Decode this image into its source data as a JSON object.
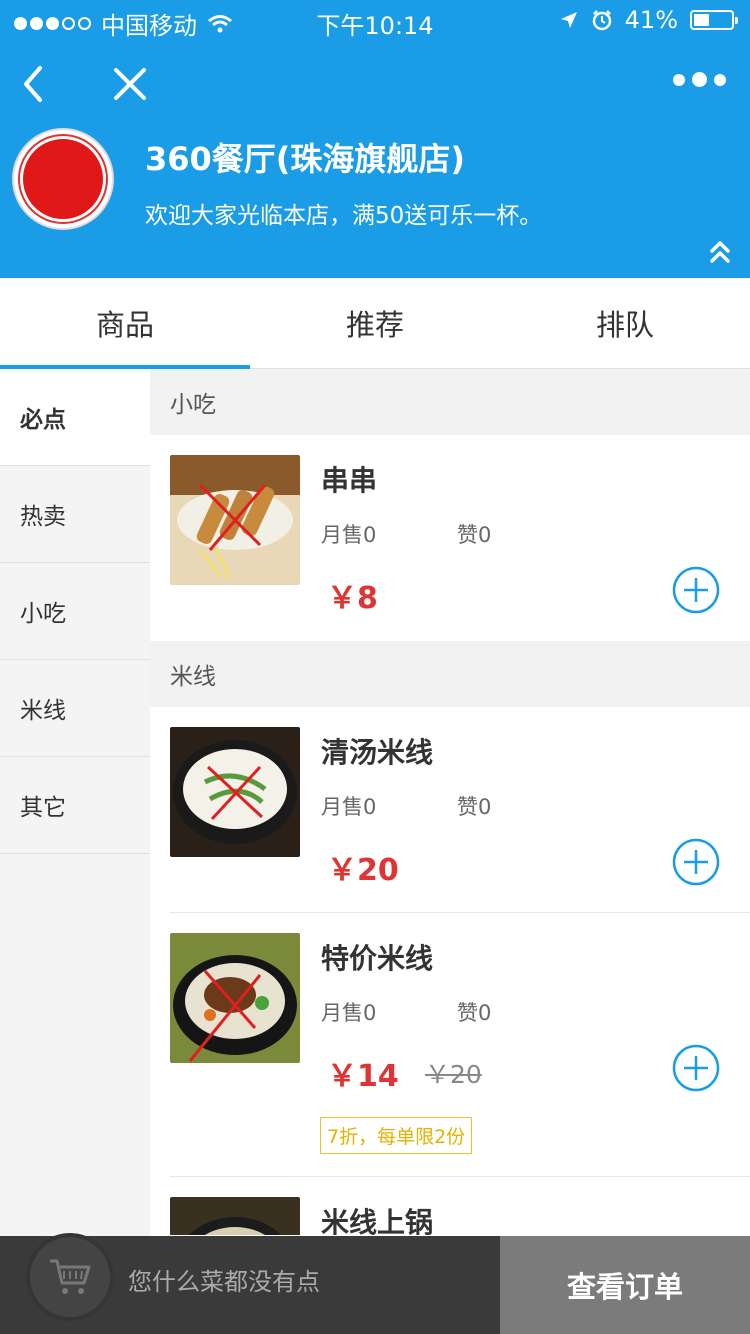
{
  "status_bar": {
    "carrier": "中国移动",
    "time": "下午10:14",
    "battery": "41%",
    "battery_level": 0.41
  },
  "shop": {
    "name": "360餐厅(珠海旗舰店)",
    "notice": "欢迎大家光临本店，满50送可乐一杯。"
  },
  "tabs": [
    {
      "label": "商品",
      "active": true
    },
    {
      "label": "推荐",
      "active": false
    },
    {
      "label": "排队",
      "active": false
    }
  ],
  "sidebar": {
    "items": [
      {
        "label": "必点",
        "active": true
      },
      {
        "label": "热卖",
        "active": false
      },
      {
        "label": "小吃",
        "active": false
      },
      {
        "label": "米线",
        "active": false
      },
      {
        "label": "其它",
        "active": false
      }
    ]
  },
  "sections": [
    {
      "title": "小吃",
      "items": [
        {
          "name": "串串",
          "sales": "月售0",
          "likes": "赞0",
          "price": "￥8"
        }
      ]
    },
    {
      "title": "米线",
      "items": [
        {
          "name": "清汤米线",
          "sales": "月售0",
          "likes": "赞0",
          "price": "￥20"
        },
        {
          "name": "特价米线",
          "sales": "月售0",
          "likes": "赞0",
          "price": "￥14",
          "old_price": "￥20",
          "promo": "7折，每单限2份"
        },
        {
          "name": "米线上锅"
        }
      ]
    }
  ],
  "bottom_bar": {
    "cart_text": "您什么菜都没有点",
    "order_button": "查看订单"
  },
  "colors": {
    "brand": "#1a9ce6",
    "price": "#e03434",
    "promo": "#e8b000"
  }
}
